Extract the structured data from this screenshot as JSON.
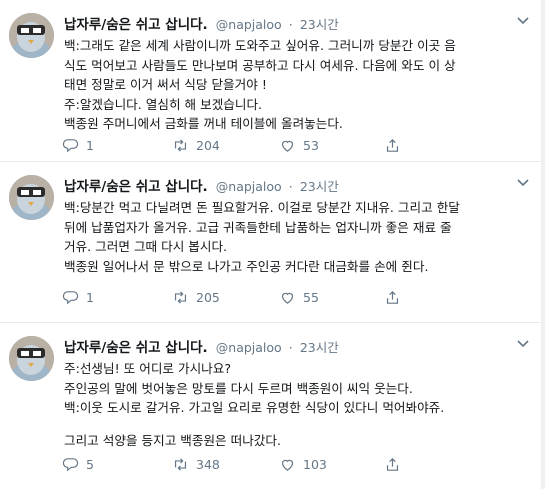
{
  "tweets": [
    {
      "name": "납자루/숨은 쉬고 삽니다.",
      "handle": "@napjaloo",
      "time": "23시간",
      "lines": [
        "백:그래도 같은 세계 사람이니까 도와주고 싶어유. 그러니까 당분간 이곳 음",
        "식도 먹어보고 사람들도 만나보며 공부하고 다시 여세유. 다음에 와도 이 상",
        "태면 정말로 이거 써서 식당 닫을거야 !",
        "주:알겠습니다. 열심히 해 보겠습니다.",
        "백종원 주머니에서 금화를 꺼내 테이블에 올려놓는다."
      ],
      "replies": "1",
      "retweets": "204",
      "likes": "53"
    },
    {
      "name": "납자루/숨은 쉬고 삽니다.",
      "handle": "@napjaloo",
      "time": "23시간",
      "lines": [
        "백:당분간 먹고 다닐려면 돈 필요할거유. 이걸로 당분간 지내유. 그리고 한달",
        "뒤에 납품업자가 올거유. 고급 귀족들한테 납품하는 업자니까 좋은 재료 줄",
        "거유. 그러면 그때 다시 봅시다.",
        "백종원 일어나서 문 밖으로 나가고 주인공 커다란 대금화를 손에 쥔다."
      ],
      "replies": "1",
      "retweets": "205",
      "likes": "55"
    },
    {
      "name": "납자루/숨은 쉬고 삽니다.",
      "handle": "@napjaloo",
      "time": "23시간",
      "lines": [
        "주:선생님! 또 어디로 가시나요?",
        "주인공의 말에 벗어놓은 망토를 다시 두르며 백종원이 씨익 웃는다.",
        "백:이웃 도시로 갈거유.  가고일 요리로 유명한 식당이 있다니 먹어봐야쥬.",
        "",
        "그리고 석양을 등지고 백종원은 떠나갔다."
      ],
      "replies": "5",
      "retweets": "348",
      "likes": "103"
    }
  ],
  "separator": "·",
  "icons": {
    "reply": "reply-icon",
    "retweet": "retweet-icon",
    "like": "like-icon",
    "share": "share-icon",
    "caret": "chevron-down-icon"
  },
  "colors": {
    "text": "#14171a",
    "muted": "#657786",
    "border": "#e6ecf0"
  }
}
